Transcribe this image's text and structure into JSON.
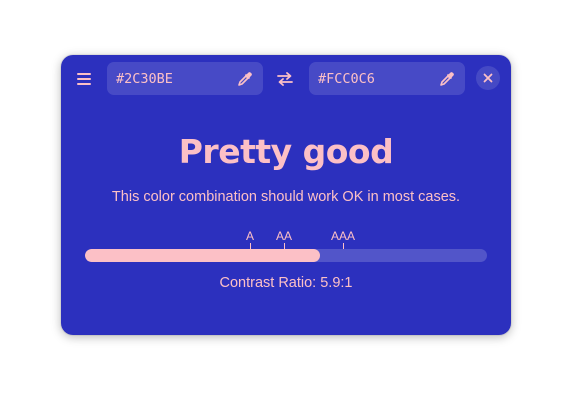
{
  "colors": {
    "background": "#2C30BE",
    "foreground": "#FCC0C6"
  },
  "header": {
    "menu_icon": "hamburger-menu-icon",
    "background_color_value": "#2C30BE",
    "foreground_color_value": "#FCC0C6",
    "picker_icon": "eyedropper-icon",
    "swap_icon": "swap-arrows-icon",
    "close_icon": "close-icon"
  },
  "main": {
    "headline": "Pretty good",
    "description": "This color combination should work OK in most cases.",
    "levels": {
      "a_label": "A",
      "aa_label": "AA",
      "aaa_label": "AAA"
    },
    "level_fill_fraction": 0.585,
    "ratio_text": "Contrast Ratio: 5.9:1"
  }
}
